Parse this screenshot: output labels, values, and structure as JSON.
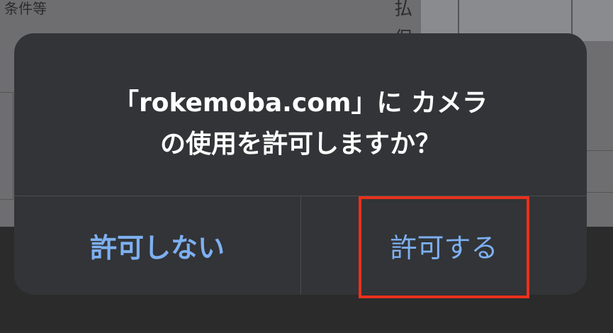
{
  "background": {
    "top_left_text": "条件等",
    "right_text": "払保"
  },
  "alert": {
    "message_line1": "「rokemoba.com」に カメラ",
    "message_line2": "の使用を許可しますか？",
    "deny_label": "許可しない",
    "allow_label": "許可する"
  },
  "annotation": {
    "highlight_color": "#e8311d"
  },
  "colors": {
    "button_text": "#7eb0f2",
    "alert_bg": "#323437"
  }
}
